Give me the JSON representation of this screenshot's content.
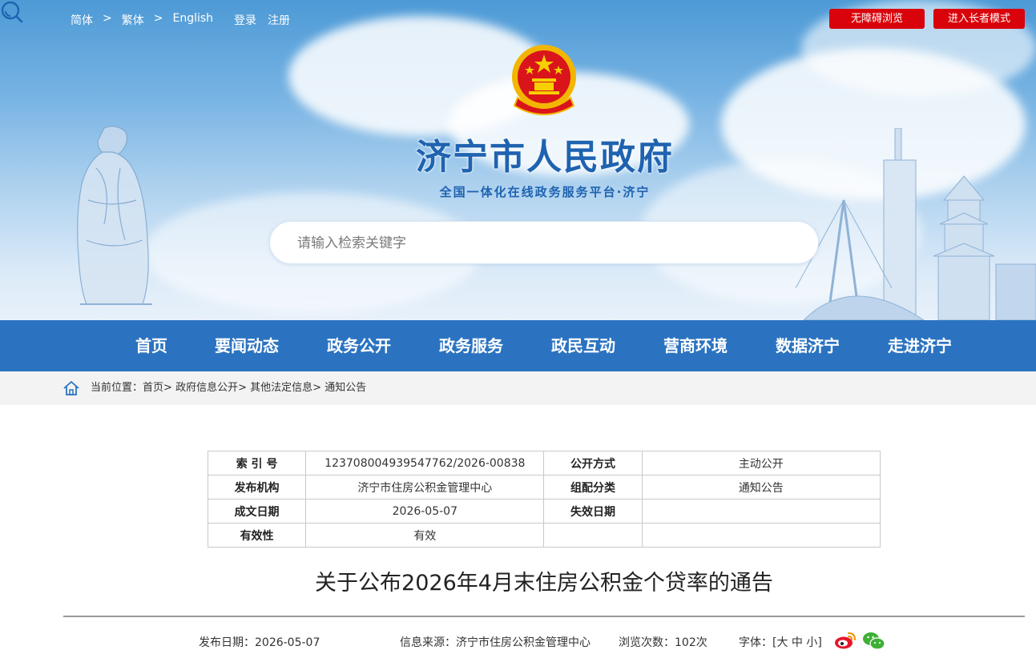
{
  "top": {
    "lang_simplified": "简体",
    "lang_traditional": "繁体",
    "lang_english": "English",
    "login": "登录",
    "register": "注册",
    "sep": ">",
    "accessible": "无障碍浏览",
    "elder_mode": "进入长者模式"
  },
  "header": {
    "title": "济宁市人民政府",
    "subtitle": "全国一体化在线政务服务平台·济宁"
  },
  "search": {
    "placeholder": "请输入检索关键字"
  },
  "nav": {
    "items": [
      {
        "label": "首页"
      },
      {
        "label": "要闻动态"
      },
      {
        "label": "政务公开"
      },
      {
        "label": "政务服务"
      },
      {
        "label": "政民互动"
      },
      {
        "label": "营商环境"
      },
      {
        "label": "数据济宁"
      },
      {
        "label": "走进济宁"
      }
    ]
  },
  "breadcrumb": {
    "prefix": "当前位置：",
    "items": [
      "首页",
      "政府信息公开",
      "其他法定信息",
      "通知公告"
    ],
    "sep": ">"
  },
  "info": {
    "rows": [
      {
        "k1": "索 引 号",
        "v1": "123708004939547762/2026-00838",
        "k2": "公开方式",
        "v2": "主动公开"
      },
      {
        "k1": "发布机构",
        "v1": "济宁市住房公积金管理中心",
        "k2": "组配分类",
        "v2": "通知公告"
      },
      {
        "k1": "成文日期",
        "v1": "2026-05-07",
        "k2": "失效日期",
        "v2": ""
      },
      {
        "k1": "有效性",
        "v1": "有效",
        "k2": "",
        "v2": ""
      }
    ]
  },
  "article": {
    "title": "关于公布2026年4月末住房公积金个贷率的通告",
    "publish_label": "发布日期：",
    "publish_date": "2026-05-07",
    "source_label": "信息来源：",
    "source": "济宁市住房公积金管理中心",
    "views_label": "浏览次数：",
    "views": "102次",
    "font_label": "字体：",
    "font_open": "[",
    "font_large": "大",
    "font_medium": "中",
    "font_small": "小",
    "font_close": "]"
  },
  "colors": {
    "nav_blue": "#2b73c1",
    "title_blue": "#1f63b0",
    "button_red": "#d9030b"
  }
}
